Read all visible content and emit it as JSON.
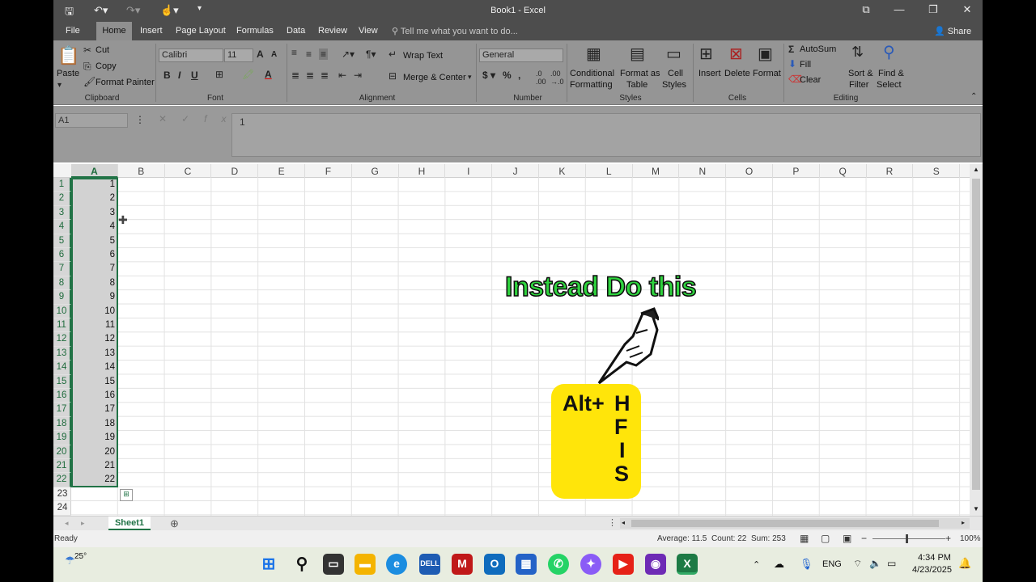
{
  "window": {
    "title": "Book1 - Excel"
  },
  "menu": {
    "tabs": [
      "File",
      "Home",
      "Insert",
      "Page Layout",
      "Formulas",
      "Data",
      "Review",
      "View"
    ],
    "tellme": "Tell me what you want to do...",
    "share": "Share"
  },
  "ribbon": {
    "clipboard": {
      "paste": "Paste",
      "cut": "Cut",
      "copy": "Copy",
      "format_painter": "Format Painter",
      "label": "Clipboard"
    },
    "font": {
      "name": "Calibri",
      "size": "11",
      "label": "Font"
    },
    "alignment": {
      "wrap": "Wrap Text",
      "merge": "Merge & Center",
      "label": "Alignment"
    },
    "number": {
      "format": "General",
      "label": "Number"
    },
    "styles": {
      "conditional": "Conditional",
      "formatting": "Formatting",
      "format_as": "Format as",
      "table": "Table",
      "cell": "Cell",
      "cell_styles": "Styles",
      "label": "Styles"
    },
    "cells": {
      "insert": "Insert",
      "delete": "Delete",
      "format": "Format",
      "label": "Cells"
    },
    "editing": {
      "autosum": "AutoSum",
      "fill": "Fill",
      "clear": "Clear",
      "sort1": "Sort &",
      "sort2": "Filter",
      "find1": "Find &",
      "find2": "Select",
      "label": "Editing"
    }
  },
  "formula_bar": {
    "name_box": "A1",
    "value": "1"
  },
  "grid": {
    "columns": [
      "A",
      "B",
      "C",
      "D",
      "E",
      "F",
      "G",
      "H",
      "I",
      "J",
      "K",
      "L",
      "M",
      "N",
      "O",
      "P",
      "Q",
      "R",
      "S"
    ],
    "rows": [
      "1",
      "2",
      "3",
      "4",
      "5",
      "6",
      "7",
      "8",
      "9",
      "10",
      "11",
      "12",
      "13",
      "14",
      "15",
      "16",
      "17",
      "18",
      "19",
      "20",
      "21",
      "22",
      "23",
      "24"
    ],
    "column_a_values": [
      "1",
      "2",
      "3",
      "4",
      "5",
      "6",
      "7",
      "8",
      "9",
      "10",
      "11",
      "12",
      "13",
      "14",
      "15",
      "16",
      "17",
      "18",
      "19",
      "20",
      "21",
      "22"
    ],
    "selected_column": "A"
  },
  "sheets": {
    "active": "Sheet1"
  },
  "status": {
    "mode": "Ready",
    "average": "Average: 11.5",
    "count": "Count: 22",
    "sum": "Sum: 253",
    "zoom": "100%"
  },
  "taskbar": {
    "weather": "25°",
    "lang": "ENG",
    "time": "4:34 PM",
    "date": "4/23/2025"
  },
  "overlay": {
    "title": "Instead Do this",
    "prefix": "Alt+",
    "keys": [
      "H",
      "F",
      "I",
      "S"
    ]
  },
  "colors": {
    "excel_green": "#217346",
    "overlay_green": "#2fd33e",
    "card_yellow": "#ffe50a"
  }
}
